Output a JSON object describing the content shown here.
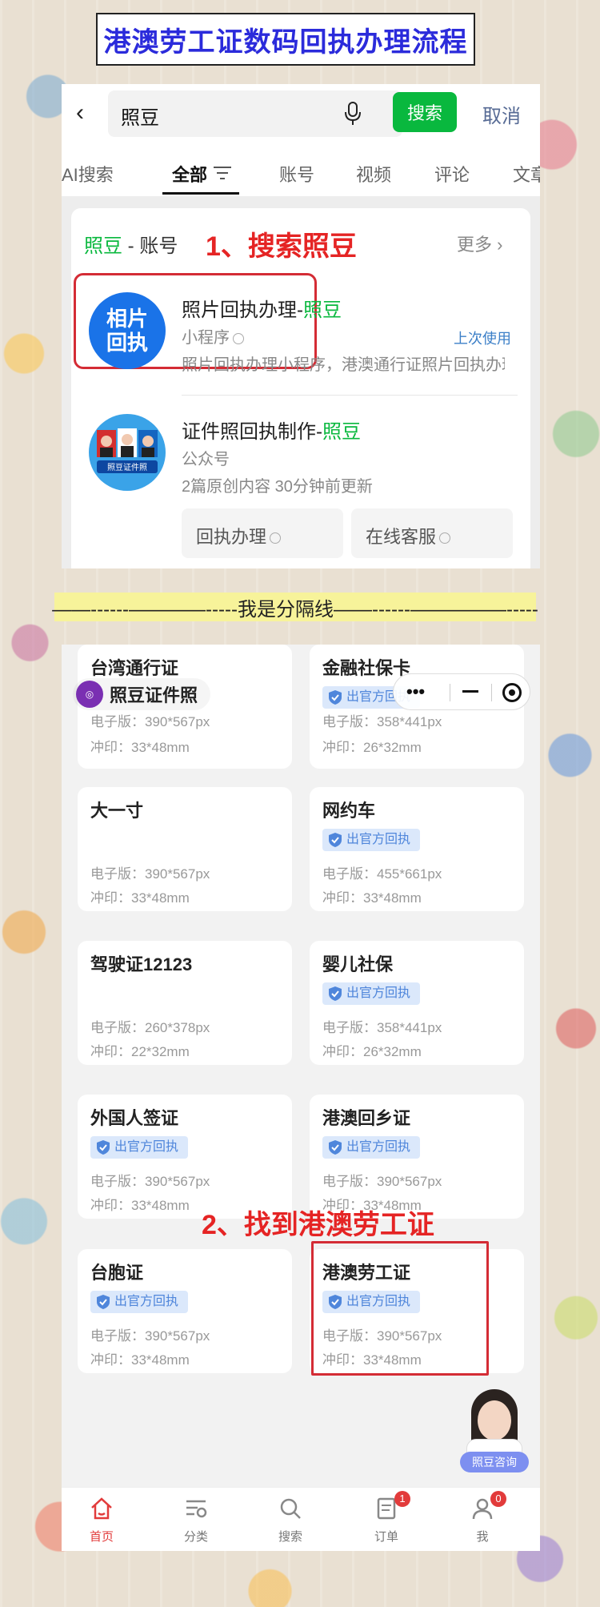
{
  "header": {
    "title": "港澳劳工证数码回执办理流程"
  },
  "search": {
    "back_glyph": "‹",
    "query": "照豆",
    "search_button": "搜索",
    "cancel": "取消",
    "tabs": [
      "AI搜索",
      "全部",
      "账号",
      "视频",
      "评论",
      "文章"
    ],
    "section_keyword": "照豆",
    "section_suffix": " - 账号",
    "more": "更多 ›",
    "step_label": "1、搜索照豆",
    "results": [
      {
        "avatar_text": "相片\n回执",
        "title_prefix": "照片回执办理-",
        "title_highlight": "照豆",
        "type": "小程序",
        "badge": "上次使用",
        "desc": "照片回执办理小程序，港澳通行证照片回执办理，"
      },
      {
        "avatar_text": "照豆证件照",
        "title_prefix": "证件照回执制作-",
        "title_highlight": "照豆",
        "type": "公众号",
        "desc": "2篇原创内容  30分钟前更新",
        "chips": [
          "回执办理",
          "在线客服"
        ]
      }
    ]
  },
  "separator": {
    "text": "——------————-----我是分隔线——------—————-----"
  },
  "miniapp": {
    "brand_name": "照豆证件照",
    "capsule_dots": "•••",
    "official_badge": "出官方回执",
    "step_label": "2、找到港澳劳工证",
    "consult_label": "照豆咨询",
    "cards": [
      {
        "name": "台湾通行证",
        "badge": false,
        "spec_e": "电子版：390*567px",
        "spec_p": "冲印：33*48mm"
      },
      {
        "name": "金融社保卡",
        "badge": true,
        "spec_e": "电子版：358*441px",
        "spec_p": "冲印：26*32mm"
      },
      {
        "name": "大一寸",
        "badge": false,
        "spec_e": "电子版：390*567px",
        "spec_p": "冲印：33*48mm"
      },
      {
        "name": "网约车",
        "badge": true,
        "spec_e": "电子版：455*661px",
        "spec_p": "冲印：33*48mm"
      },
      {
        "name": "驾驶证12123",
        "badge": false,
        "spec_e": "电子版：260*378px",
        "spec_p": "冲印：22*32mm"
      },
      {
        "name": "婴儿社保",
        "badge": true,
        "spec_e": "电子版：358*441px",
        "spec_p": "冲印：26*32mm"
      },
      {
        "name": "外国人签证",
        "badge": true,
        "spec_e": "电子版：390*567px",
        "spec_p": "冲印：33*48mm"
      },
      {
        "name": "港澳回乡证",
        "badge": true,
        "spec_e": "电子版：390*567px",
        "spec_p": "冲印：33*48mm"
      },
      {
        "name": "台胞证",
        "badge": true,
        "spec_e": "电子版：390*567px",
        "spec_p": "冲印：33*48mm"
      },
      {
        "name": "港澳劳工证",
        "badge": true,
        "spec_e": "电子版：390*567px",
        "spec_p": "冲印：33*48mm"
      }
    ],
    "tabbar": [
      {
        "label": "首页",
        "active": true
      },
      {
        "label": "分类"
      },
      {
        "label": "搜索"
      },
      {
        "label": "订单",
        "badge": "1"
      },
      {
        "label": "我",
        "badge": "0"
      }
    ]
  },
  "colors": {
    "title_text": "#2b2bdb",
    "search_button": "#09b83e",
    "highlight": "#09b83e",
    "annotation_red": "#e52424",
    "official_badge_bg": "#dbe8fb",
    "official_badge_text": "#4f86db",
    "tab_active": "#e23b3b"
  }
}
